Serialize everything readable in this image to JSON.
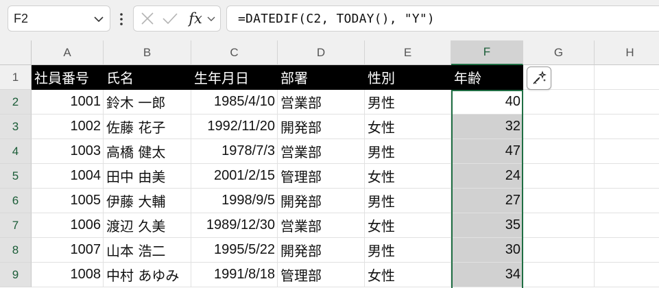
{
  "formula_bar": {
    "name_box_value": "F2",
    "formula": "=DATEDIF(C2, TODAY(), \"Y\")",
    "fx_label": "fx"
  },
  "columns": [
    "A",
    "B",
    "C",
    "D",
    "E",
    "F",
    "G",
    "H"
  ],
  "rows": [
    "1",
    "2",
    "3",
    "4",
    "5",
    "6",
    "7",
    "8",
    "9"
  ],
  "header_row": [
    "社員番号",
    "氏名",
    "生年月日",
    "部署",
    "性別",
    "年齢"
  ],
  "data_rows": [
    [
      "1001",
      "鈴木 一郎",
      "1985/4/10",
      "営業部",
      "男性",
      "40"
    ],
    [
      "1002",
      "佐藤 花子",
      "1992/11/20",
      "開発部",
      "女性",
      "32"
    ],
    [
      "1003",
      "高橋 健太",
      "1978/7/3",
      "営業部",
      "男性",
      "47"
    ],
    [
      "1004",
      "田中 由美",
      "2001/2/15",
      "管理部",
      "女性",
      "24"
    ],
    [
      "1005",
      "伊藤 大輔",
      "1998/9/5",
      "開発部",
      "男性",
      "27"
    ],
    [
      "1006",
      "渡辺 久美",
      "1989/12/30",
      "営業部",
      "女性",
      "35"
    ],
    [
      "1007",
      "山本 浩二",
      "1995/5/22",
      "開発部",
      "男性",
      "30"
    ],
    [
      "1008",
      "中村 あゆみ",
      "1991/8/18",
      "管理部",
      "女性",
      "34"
    ]
  ],
  "colors": {
    "header_bg": "#000000",
    "header_text": "#ffffff",
    "selection_border": "#1f6e43",
    "selection_fill": "#d1d1d1"
  },
  "icons": {
    "quick_analysis": "sparkle-pen-icon",
    "cancel": "x-icon",
    "confirm": "check-icon"
  }
}
